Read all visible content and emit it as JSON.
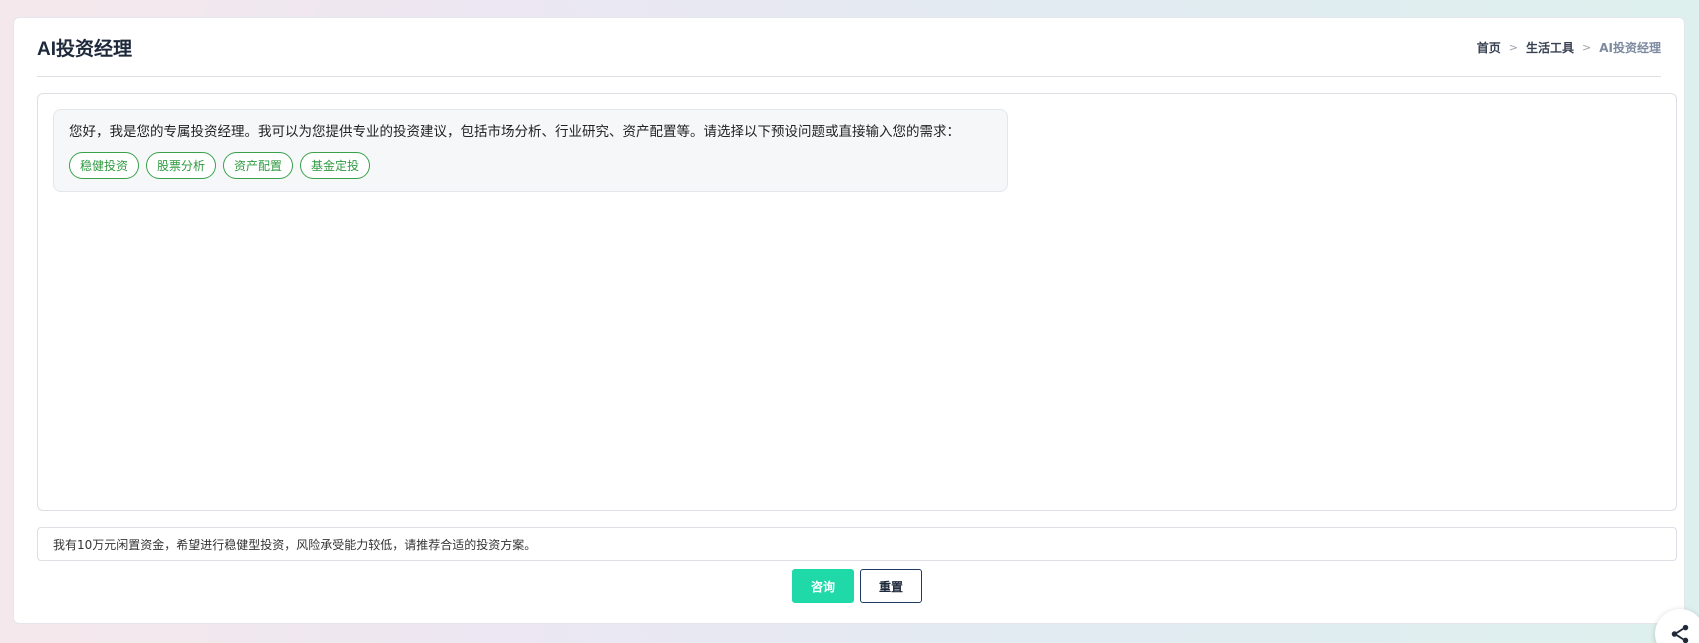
{
  "header": {
    "title": "AI投资经理",
    "breadcrumb": [
      {
        "label": "首页"
      },
      {
        "label": "生活工具"
      },
      {
        "label": "AI投资经理"
      }
    ],
    "separator": ">"
  },
  "chat": {
    "welcome_message": "您好，我是您的专属投资经理。我可以为您提供专业的投资建议，包括市场分析、行业研究、资产配置等。请选择以下预设问题或直接输入您的需求：",
    "preset_questions": [
      "稳健投资",
      "股票分析",
      "资产配置",
      "基金定投"
    ]
  },
  "input": {
    "value": "我有10万元闲置资金，希望进行稳健型投资，风险承受能力较低，请推荐合适的投资方案。"
  },
  "actions": {
    "submit_label": "咨询",
    "reset_label": "重置"
  },
  "icons": {
    "share": "share-icon"
  },
  "colors": {
    "accent": "#20d9a8",
    "chip_green": "#38a14a",
    "dark_navy": "#1e3a5f"
  }
}
